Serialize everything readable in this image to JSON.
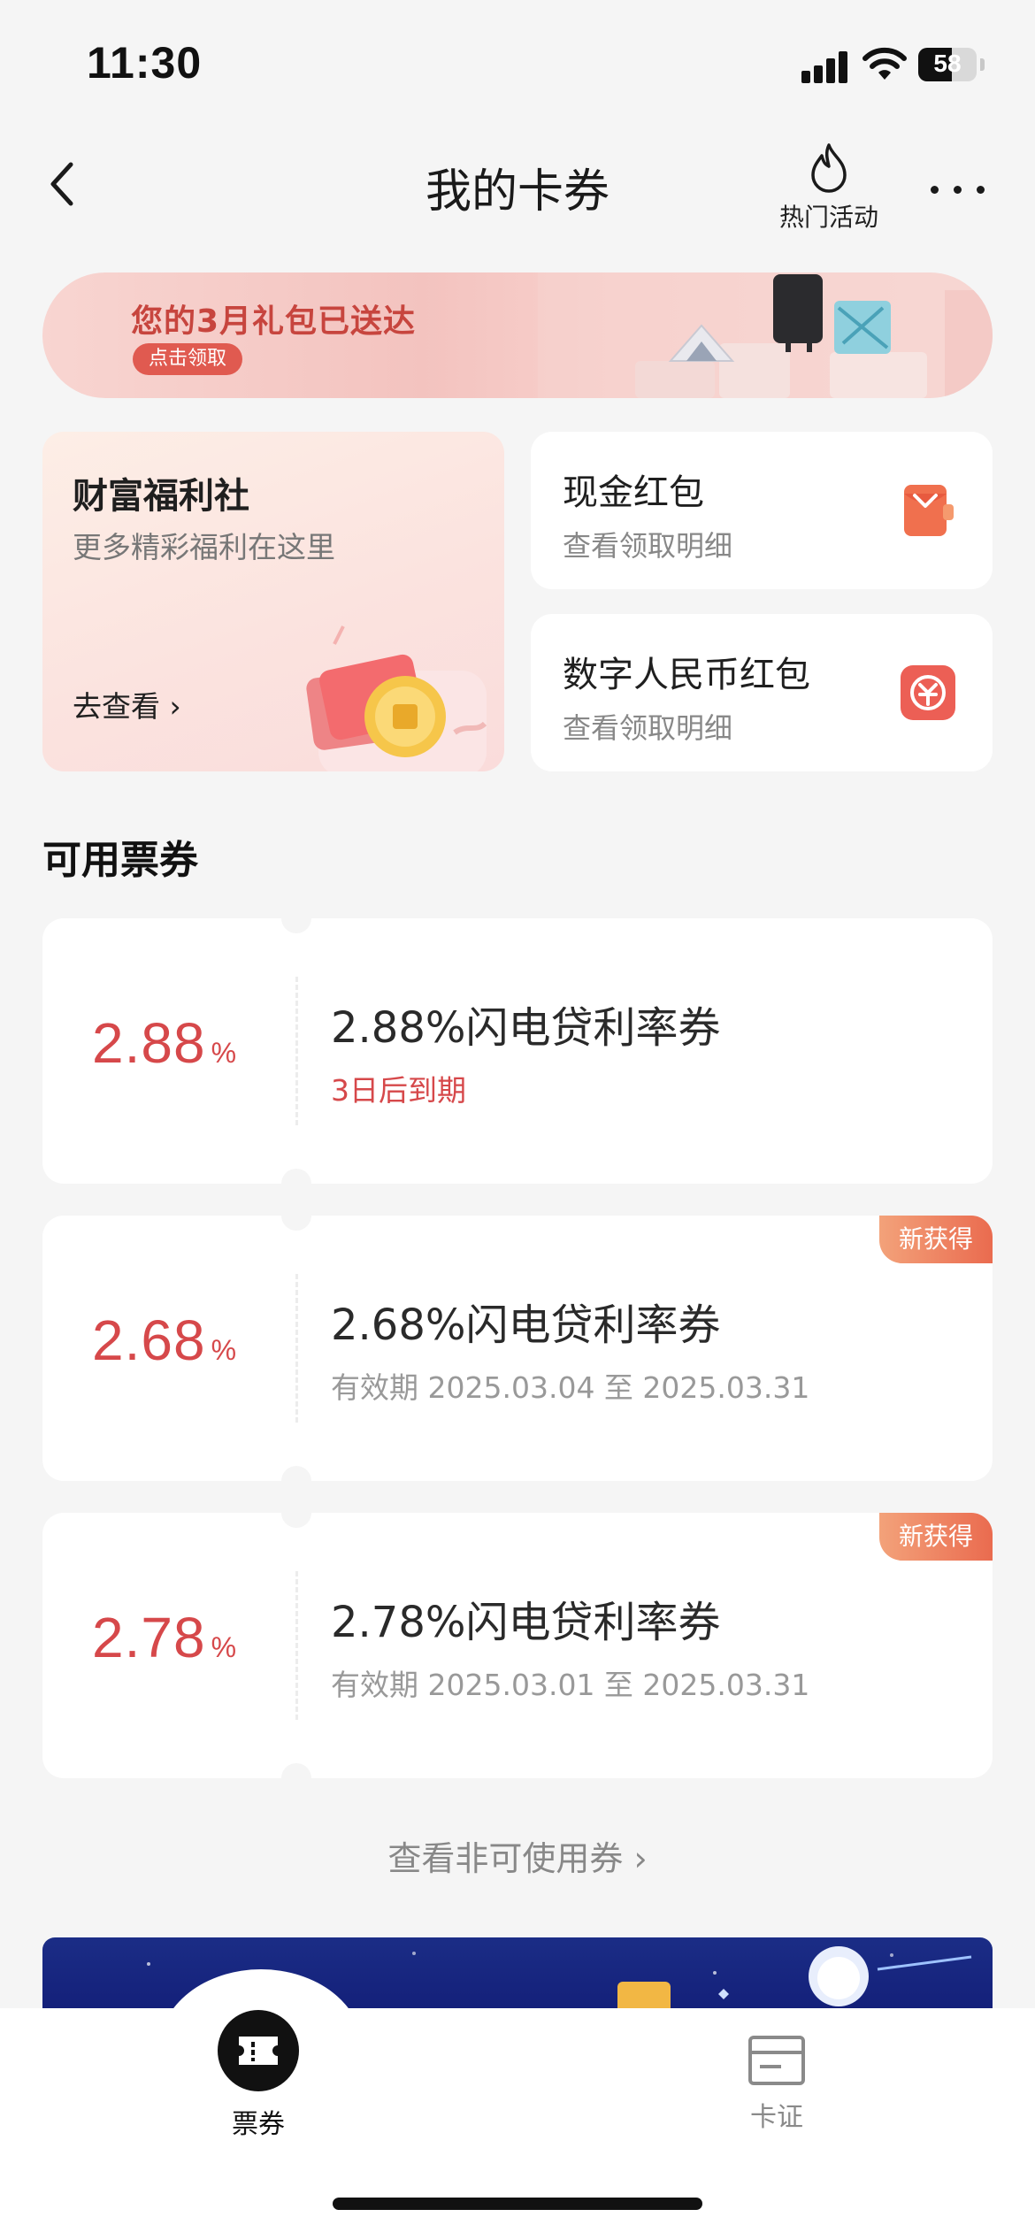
{
  "status_bar": {
    "time": "11:30",
    "battery": "58",
    "battery_level": 0.58
  },
  "nav": {
    "title": "我的卡券",
    "hot_label": "热门活动",
    "back_icon": "chevron-left-icon",
    "more_icon": "more-icon"
  },
  "promo": {
    "title": "您的3月礼包已送达",
    "cta": "点击领取"
  },
  "welfare": {
    "title": "财富福利社",
    "subtitle": "更多精彩福利在这里",
    "link": "去查看 ›"
  },
  "cash_red_packet": {
    "title": "现金红包",
    "subtitle": "查看领取明细",
    "icon": "red-packet-icon"
  },
  "digital_rmb_red_packet": {
    "title": "数字人民币红包",
    "subtitle": "查看领取明细",
    "icon": "digital-rmb-icon"
  },
  "section": {
    "title": "可用票券"
  },
  "coupons": [
    {
      "rate": "2.88",
      "unit": "%",
      "name": "2.88%闪电贷利率券",
      "meta": "3日后到期",
      "badge": ""
    },
    {
      "rate": "2.68",
      "unit": "%",
      "name": "2.68%闪电贷利率券",
      "meta": "有效期 2025.03.04 至 2025.03.31",
      "badge": "新获得"
    },
    {
      "rate": "2.78",
      "unit": "%",
      "name": "2.78%闪电贷利率券",
      "meta": "有效期 2025.03.01 至 2025.03.31",
      "badge": "新获得"
    }
  ],
  "view_unusable": "查看非可使用券 ›",
  "tabs": [
    {
      "label": "票券",
      "icon": "ticket-icon",
      "active": true
    },
    {
      "label": "卡证",
      "icon": "card-icon",
      "active": false
    }
  ],
  "colors": {
    "accent": "#d6484a",
    "badge": "#ea6b4f",
    "background": "#f5f5f5"
  }
}
